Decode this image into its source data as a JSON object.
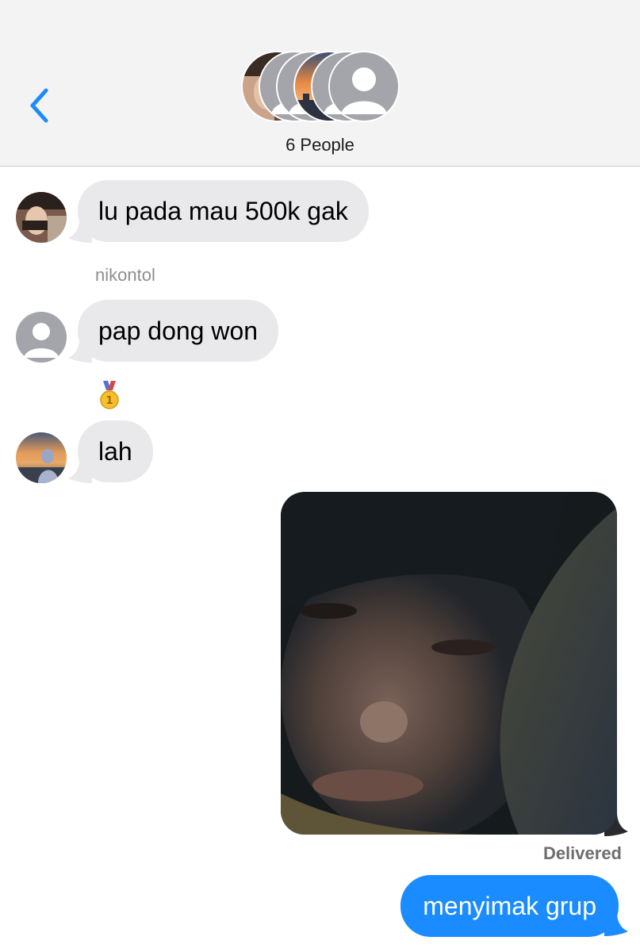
{
  "header": {
    "group_count": "6 People"
  },
  "messages": [
    {
      "direction": "incoming",
      "sender": "",
      "text": "lu pada mau 500k gak"
    },
    {
      "direction": "incoming",
      "sender": "nikontol",
      "text": "pap dong won"
    },
    {
      "direction": "incoming",
      "sender": "",
      "reaction_icon": "medal-icon",
      "text": "lah"
    },
    {
      "direction": "outgoing",
      "type": "photo",
      "status": "Delivered"
    },
    {
      "direction": "outgoing",
      "text": "menyimak grup"
    }
  ],
  "colors": {
    "accent": "#1a8cff",
    "incoming_bubble": "#e9e9eb",
    "header_bg": "#f3f3f3"
  }
}
